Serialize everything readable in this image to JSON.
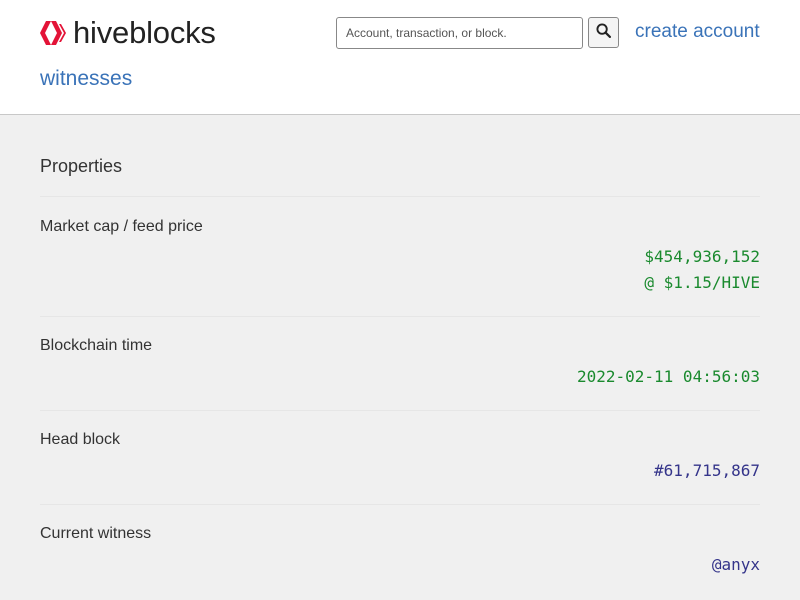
{
  "header": {
    "logo_text": "hiveblocks",
    "search": {
      "placeholder": "Account, transaction, or block."
    },
    "create_account": "create account",
    "nav": {
      "witnesses": "witnesses"
    }
  },
  "properties": {
    "title": "Properties",
    "market_cap": {
      "label": "Market cap / feed price",
      "value": "$454,936,152",
      "price": "@ $1.15/HIVE"
    },
    "blockchain_time": {
      "label": "Blockchain time",
      "value": "2022-02-11 04:56:03"
    },
    "head_block": {
      "label": "Head block",
      "value": "#61,715,867"
    },
    "current_witness": {
      "label": "Current witness",
      "value": "@anyx"
    }
  },
  "colors": {
    "link": "#3a73b8",
    "brand": "#e31337",
    "value_green": "#1a8a2e",
    "value_blue": "#34348a"
  },
  "icons": {
    "logo": "hive-logo-icon",
    "search": "search-icon"
  }
}
